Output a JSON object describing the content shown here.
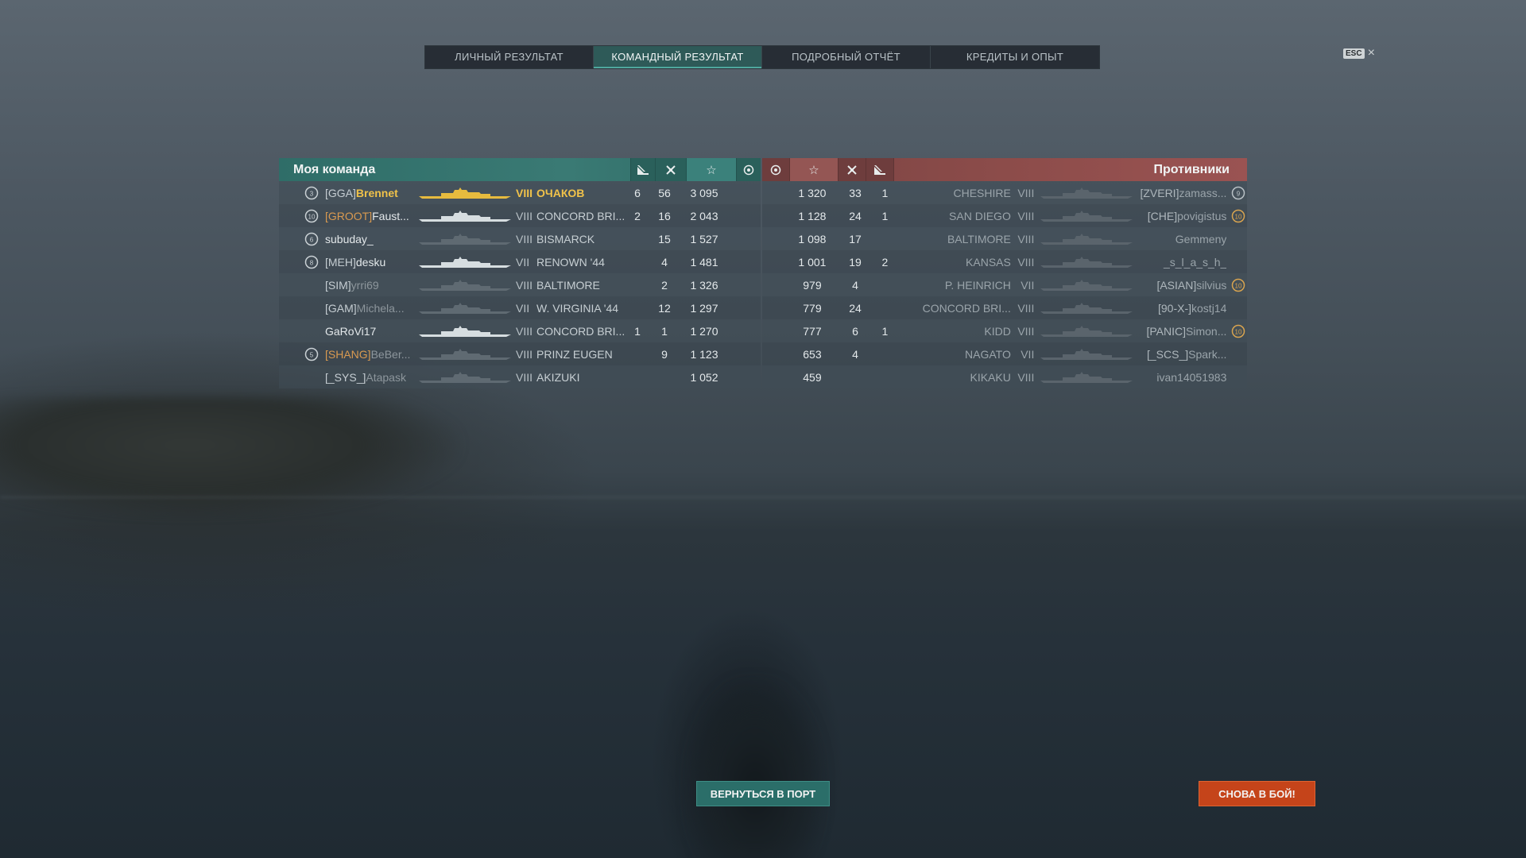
{
  "tabs": [
    {
      "label": "ЛИЧНЫЙ РЕЗУЛЬТАТ",
      "active": false
    },
    {
      "label": "КОМАНДНЫЙ РЕЗУЛЬТАТ",
      "active": true
    },
    {
      "label": "ПОДРОБНЫЙ ОТЧЁТ",
      "active": false
    },
    {
      "label": "КРЕДИТЫ И ОПЫТ",
      "active": false
    }
  ],
  "esc": {
    "key": "ESC",
    "close": "×"
  },
  "my_team": {
    "title": "Моя команда",
    "icons": [
      "ships-destroyed-icon",
      "planes-destroyed-icon",
      "base-xp-star-icon",
      "capture-icon"
    ],
    "rows": [
      {
        "rank": "3",
        "tag": "[GGA]",
        "name": "Brennet",
        "tier": "VIII",
        "ship": "ОЧАКОВ",
        "kills": "6",
        "planes": "56",
        "xp": "3 095",
        "highlight": true
      },
      {
        "rank": "10",
        "tag": "[GROOT]",
        "name": "Faust...",
        "tier": "VIII",
        "ship": "CONCORD BRI...",
        "kills": "2",
        "planes": "16",
        "xp": "2 043"
      },
      {
        "rank": "6",
        "tag": "",
        "name": "subuday_",
        "tier": "VIII",
        "ship": "BISMARCK",
        "kills": "",
        "planes": "15",
        "xp": "1 527"
      },
      {
        "rank": "8",
        "tag": "[MEH]",
        "name": "desku",
        "tier": "VII",
        "ship": "RENOWN '44",
        "kills": "",
        "planes": "4",
        "xp": "1 481"
      },
      {
        "rank": "",
        "tag": "[SIM]",
        "name": "yrri69",
        "tier": "VIII",
        "ship": "BALTIMORE",
        "kills": "",
        "planes": "2",
        "xp": "1 326"
      },
      {
        "rank": "",
        "tag": "[GAM]",
        "name": "Michela...",
        "tier": "VII",
        "ship": "W. VIRGINIA '44",
        "kills": "",
        "planes": "12",
        "xp": "1 297"
      },
      {
        "rank": "",
        "tag": "",
        "name": "GaRoVi17",
        "tier": "VIII",
        "ship": "CONCORD BRI...",
        "kills": "1",
        "planes": "1",
        "xp": "1 270"
      },
      {
        "rank": "5",
        "tag": "[SHANG]",
        "name": "BeBer...",
        "tier": "VIII",
        "ship": "PRINZ EUGEN",
        "kills": "",
        "planes": "9",
        "xp": "1 123"
      },
      {
        "rank": "",
        "tag": "[_SYS_]",
        "name": "Atapask",
        "tier": "VIII",
        "ship": "AKIZUKI",
        "kills": "",
        "planes": "",
        "xp": "1 052"
      }
    ]
  },
  "enemy_team": {
    "title": "Противники",
    "rows": [
      {
        "xp": "1 320",
        "planes": "33",
        "kills": "1",
        "ship": "CHESHIRE",
        "tier": "VIII",
        "tag": "[ZVERI]",
        "name": "zamass...",
        "rank": "9"
      },
      {
        "xp": "1 128",
        "planes": "24",
        "kills": "1",
        "ship": "SAN DIEGO",
        "tier": "VIII",
        "tag": "[CHE]",
        "name": "povigistus",
        "rank": "10"
      },
      {
        "xp": "1 098",
        "planes": "17",
        "kills": "",
        "ship": "BALTIMORE",
        "tier": "VIII",
        "tag": "",
        "name": "Gemmeny",
        "rank": ""
      },
      {
        "xp": "1 001",
        "planes": "19",
        "kills": "2",
        "ship": "KANSAS",
        "tier": "VIII",
        "tag": "",
        "name": "_s_l_a_s_h_",
        "rank": ""
      },
      {
        "xp": "979",
        "planes": "4",
        "kills": "",
        "ship": "P. HEINRICH",
        "tier": "VII",
        "tag": "[ASIAN]",
        "name": "silvius",
        "rank": "10"
      },
      {
        "xp": "779",
        "planes": "24",
        "kills": "",
        "ship": "CONCORD BRI...",
        "tier": "VIII",
        "tag": "[90-X-]",
        "name": "kostj14",
        "rank": ""
      },
      {
        "xp": "777",
        "planes": "6",
        "kills": "1",
        "ship": "KIDD",
        "tier": "VIII",
        "tag": "[PANIC]",
        "name": "Simon...",
        "rank": "10"
      },
      {
        "xp": "653",
        "planes": "4",
        "kills": "",
        "ship": "NAGATO",
        "tier": "VII",
        "tag": "[_SCS_]",
        "name": "Spark...",
        "rank": ""
      },
      {
        "xp": "459",
        "planes": "",
        "kills": "",
        "ship": "KIKAKU",
        "tier": "VIII",
        "tag": "",
        "name": "ivan14051983",
        "rank": ""
      }
    ]
  },
  "buttons": {
    "port": "ВЕРНУТЬСЯ В ПОРТ",
    "battle": "СНОВА В БОЙ!"
  }
}
